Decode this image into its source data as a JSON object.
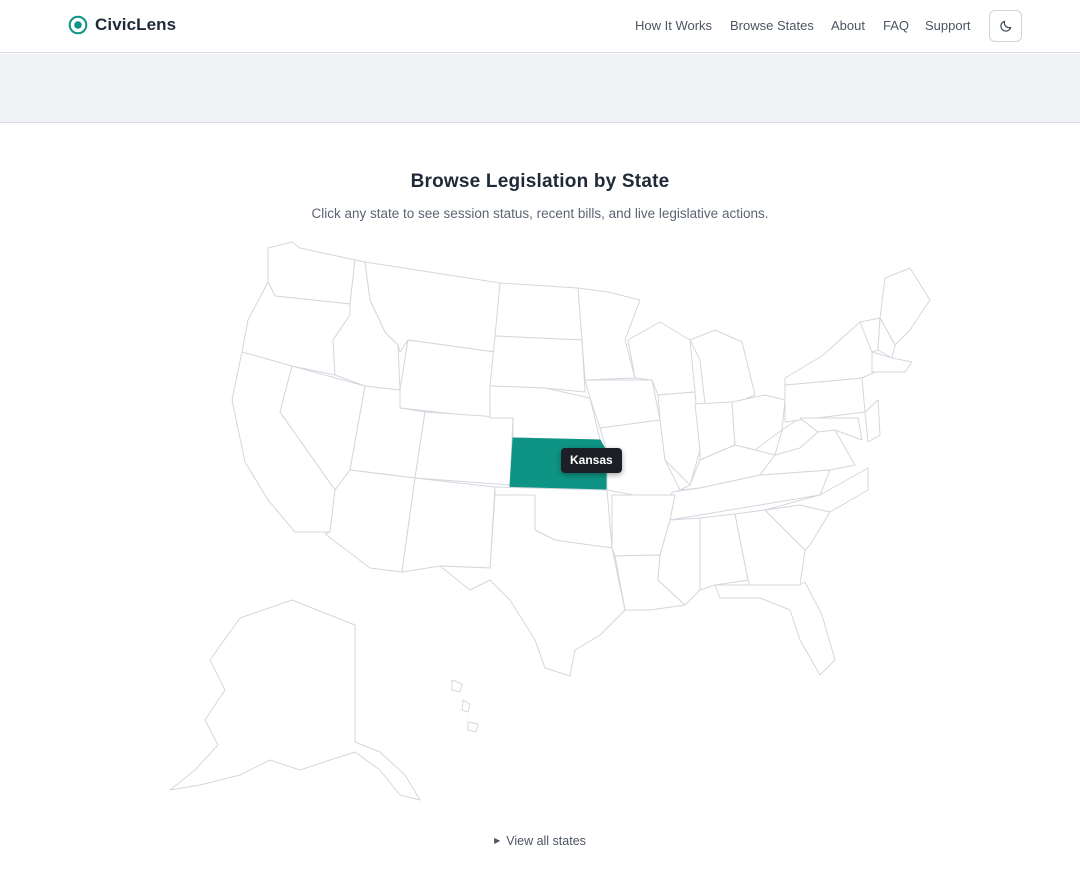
{
  "header": {
    "brand": "CivicLens",
    "nav": [
      "How It Works",
      "Browse States",
      "About",
      "FAQ",
      "Support"
    ],
    "theme_toggle_icon": "moon-icon"
  },
  "main": {
    "title": "Browse Legislation by State",
    "subtitle": "Click any state to see session status, recent bills, and live legislative actions.",
    "hovered_state": "Kansas",
    "view_all": "View all states"
  },
  "colors": {
    "accent": "#0e9484",
    "tooltip_bg": "#1c1f26",
    "banner_bg": "#f1f2f5"
  }
}
